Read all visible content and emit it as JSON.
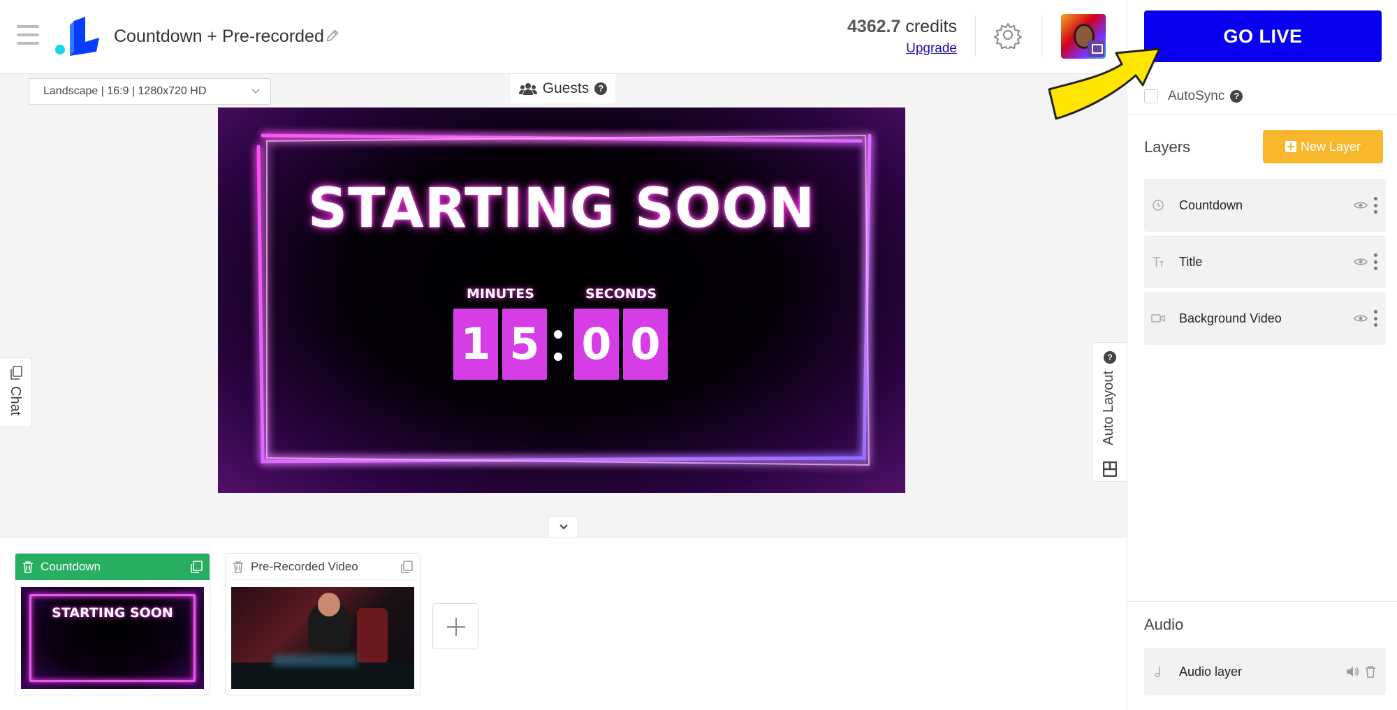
{
  "header": {
    "project_title": "Countdown + Pre-recorded",
    "credits_amount": "4362.7",
    "credits_unit": "credits",
    "upgrade_label": "Upgrade"
  },
  "right_panel": {
    "go_live_label": "GO LIVE",
    "autosync_label": "AutoSync",
    "autosync_checked": false,
    "layers_title": "Layers",
    "new_layer_label": "New Layer",
    "layers": [
      {
        "name": "Countdown",
        "icon": "clock-icon"
      },
      {
        "name": "Title",
        "icon": "text-icon"
      },
      {
        "name": "Background Video",
        "icon": "video-camera-icon"
      }
    ],
    "audio_title": "Audio",
    "audio_layer": "Audio layer"
  },
  "workarea": {
    "format_select": "Landscape | 16:9 | 1280x720 HD",
    "guests_label": "Guests",
    "chat_label": "Chat",
    "auto_layout_label": "Auto Layout"
  },
  "stage": {
    "title": "STARTING SOON",
    "minutes_label": "MINUTES",
    "seconds_label": "SECONDS",
    "digits": [
      "1",
      "5",
      "0",
      "0"
    ]
  },
  "scenes": [
    {
      "name": "Countdown",
      "active": true,
      "thumb_title": "STARTING SOON"
    },
    {
      "name": "Pre-Recorded Video",
      "active": false
    }
  ],
  "colors": {
    "go_live": "#0a00f0",
    "new_layer": "#f8b72c",
    "active_scene": "#27ae60",
    "countdown_digit": "#d63de6",
    "neon": "#ff33ee"
  }
}
